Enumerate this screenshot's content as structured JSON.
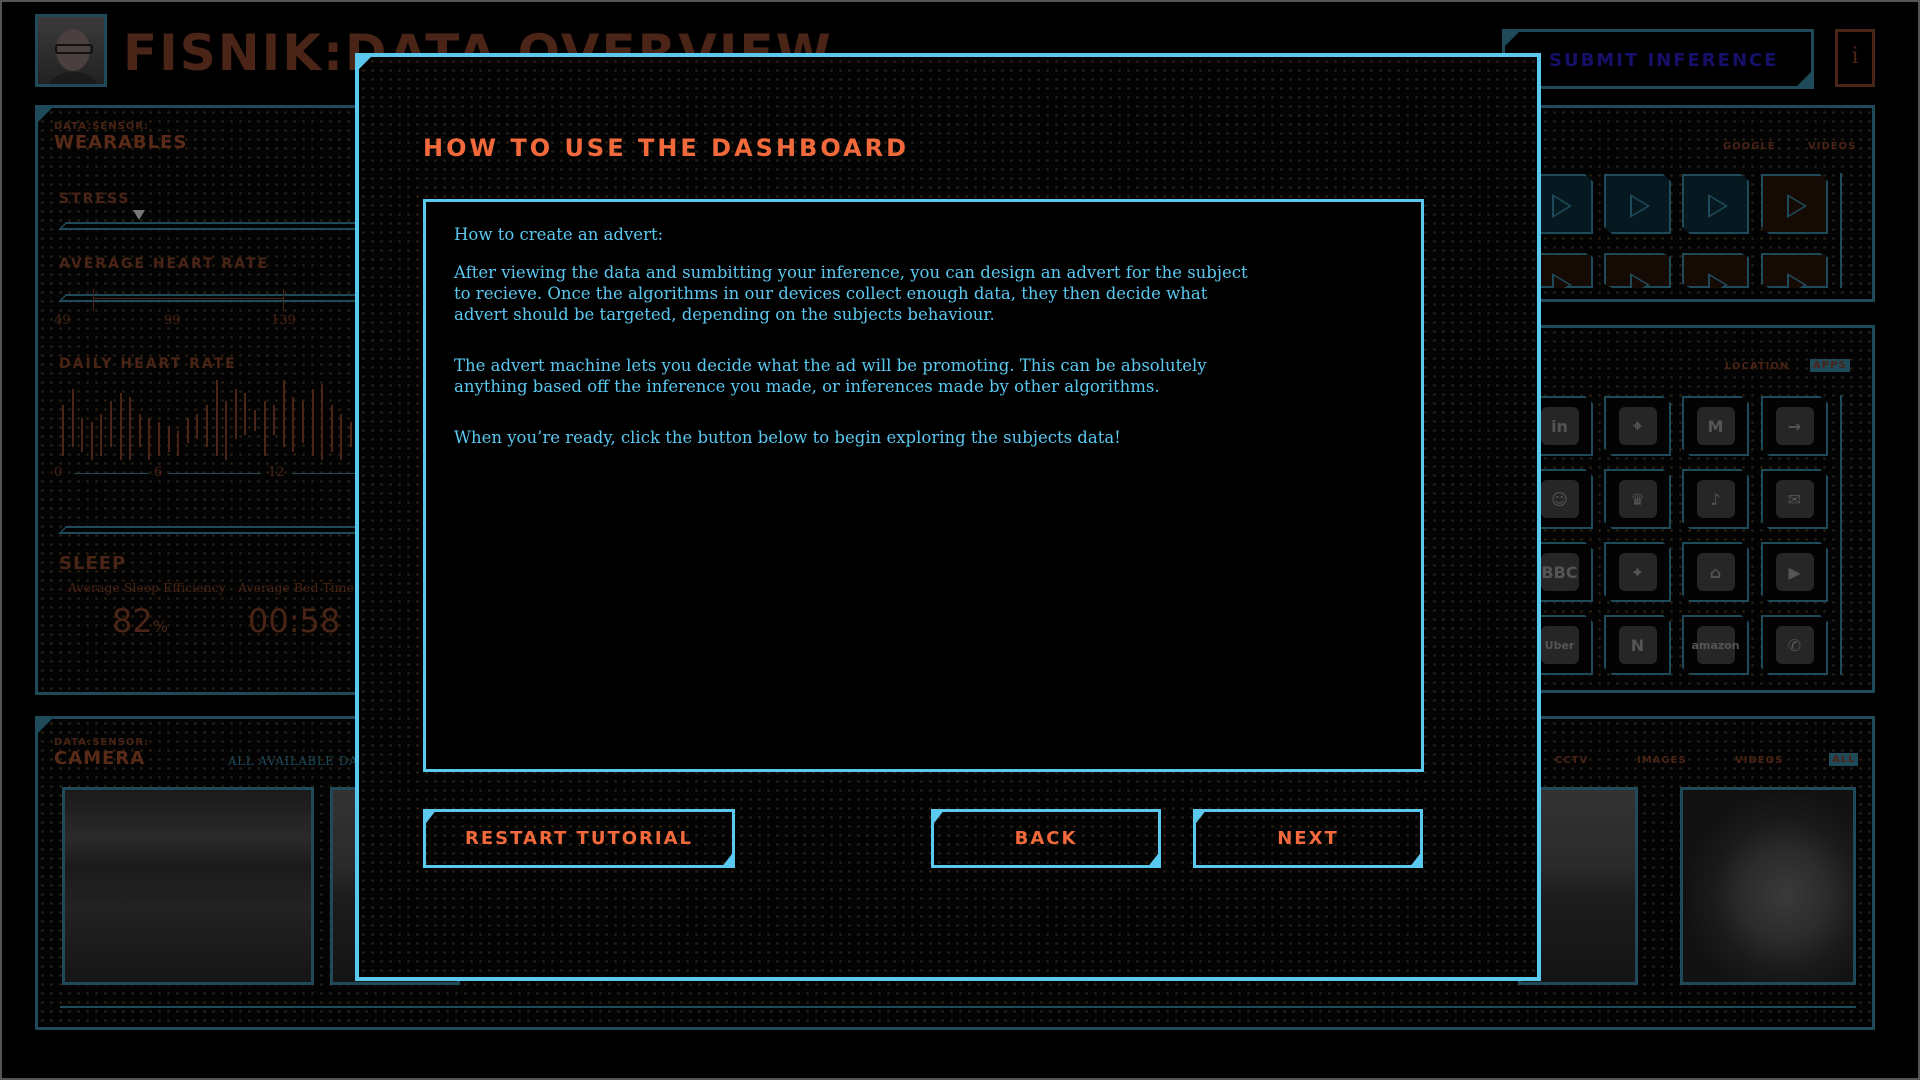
{
  "header": {
    "title": "FISNIK:DATA OVERVIEW",
    "submit_label": "SUBMIT INFERENCE",
    "info_label": "i"
  },
  "wearables": {
    "sensor_tag": "DATA:SENSOR:",
    "sensor_name": "WEARABLES",
    "stress_label": "STRESS",
    "stress_level_fraction": 0.21,
    "avg_hr_label": "AVERAGE HEART RATE",
    "avg_hr_ticks": [
      "49",
      "99",
      "139"
    ],
    "daily_hr_label": "DAILY HEART RATE",
    "daily_hr_ticks": [
      "0",
      "6",
      "12"
    ],
    "sleep_label": "SLEEP",
    "sleep_eff_label": "Average Sleep Efficiency",
    "sleep_eff_value": "82",
    "sleep_eff_unit": "%",
    "bed_time_label": "Average Bed Time",
    "bed_time_value": "00:58"
  },
  "videos_panel": {
    "tabs": [
      "GOOGLE",
      "VIDEOS"
    ]
  },
  "apps_panel": {
    "tabs": [
      "LOCATION",
      "APPS"
    ],
    "active_tab": "APPS",
    "apps": [
      "LinkedIn",
      "Maps",
      "Gmail",
      "Transit",
      "Snapchat",
      "Barclays",
      "TikTok",
      "Mail",
      "BBC News",
      "Photos",
      "Google Home",
      "YouTube",
      "Uber",
      "Netflix",
      "Amazon",
      "WhatsApp"
    ],
    "app_glyphs": [
      "in",
      "⌖",
      "M",
      "→",
      "☺",
      "♛",
      "♪",
      "✉",
      "BBC",
      "✦",
      "⌂",
      "▶",
      "Uber",
      "N",
      "amazon",
      "✆"
    ]
  },
  "camera": {
    "sensor_tag": "DATA:SENSOR:",
    "sensor_name": "CAMERA",
    "subtitle": "ALL AVAILABLE DATA F",
    "tabs": [
      "CCTV",
      "IMAGES",
      "VIDEOS",
      "ALL"
    ],
    "active_tab": "ALL"
  },
  "modal": {
    "title": "HOW TO USE THE DASHBOARD",
    "heading": "How to create an advert:",
    "paragraphs": [
      "After viewing the data and sumbitting your inference, you can design an advert for the subject\nto recieve. Once the algorithms in our devices collect enough data, they then decide what\nadvert should be targeted, depending on the subjects behaviour.",
      "The advert machine lets you decide what the ad will be promoting. This can be absolutely\nanything based off the inference you made, or inferences made by other algorithms.",
      "When you’re ready, click the button below to begin exploring the subjects data!"
    ],
    "restart_label": "RESTART TUTORIAL",
    "back_label": "BACK",
    "next_label": "NEXT"
  },
  "colors": {
    "accent_blue": "#5bc8f0",
    "accent_orange": "#f26a3c",
    "panel_border": "#1e4a5a",
    "dim_text": "#4a2416"
  }
}
